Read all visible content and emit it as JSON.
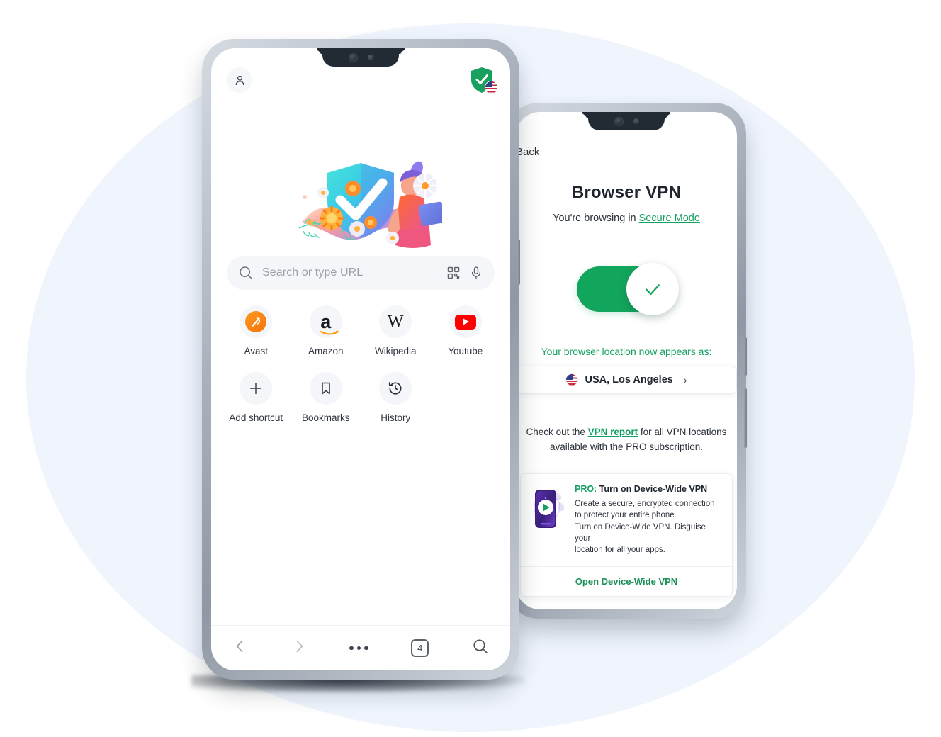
{
  "theme": {
    "brand_green": "#16a163",
    "toggle_green": "#12a55c",
    "bg_blob": "#eff4fd",
    "frame_dark": "#2b333c",
    "avast_orange": "#f4720b",
    "youtube_red": "#ff0000"
  },
  "phone1": {
    "profile_icon": "person-icon",
    "security_badge": {
      "shield_icon": "shield-check-icon",
      "flag_icon": "usa-flag-icon"
    },
    "hero_illustration": "shield-checkmark-flowers-illustration",
    "search": {
      "placeholder": "Search or type URL",
      "value": "",
      "search_icon": "search-icon",
      "qr_icon": "qr-code-icon",
      "mic_icon": "microphone-icon"
    },
    "shortcuts_row1": [
      {
        "label": "Avast",
        "icon": "avast-logo-icon"
      },
      {
        "label": "Amazon",
        "icon": "amazon-logo-icon"
      },
      {
        "label": "Wikipedia",
        "icon": "wikipedia-logo-icon"
      },
      {
        "label": "Youtube",
        "icon": "youtube-logo-icon"
      }
    ],
    "shortcuts_row2": [
      {
        "label": "Add shortcut",
        "icon": "plus-icon"
      },
      {
        "label": "Bookmarks",
        "icon": "bookmark-icon"
      },
      {
        "label": "History",
        "icon": "history-clock-icon"
      }
    ],
    "bottom_nav": {
      "back_icon": "chevron-left-icon",
      "forward_icon": "chevron-right-icon",
      "more_icon": "more-horizontal-icon",
      "tab_count": "4",
      "search_icon": "search-icon"
    }
  },
  "phone2": {
    "back_label": "Back",
    "title": "Browser VPN",
    "subtitle_prefix": "You're browsing in ",
    "subtitle_link": "Secure Mode",
    "toggle": {
      "state": "on",
      "check_icon": "check-icon"
    },
    "location_heading": "Your browser location now appears as:",
    "location_value": "USA, Los Angeles",
    "location_flag_icon": "usa-flag-icon",
    "location_chevron_icon": "chevron-right-icon",
    "report_line1_prefix": "Check out the ",
    "report_link": "VPN report",
    "report_line1_suffix": " for all VPN locations",
    "report_line2": "available with the PRO subscription.",
    "pro_card": {
      "art_icon": "phone-play-globe-icon",
      "tag": "PRO:",
      "title": " Turn on Device-Wide VPN",
      "desc_line1": "Create a secure, encrypted connection",
      "desc_line2": "to protect your entire phone.",
      "desc_line3": "Turn on Device-Wide VPN. Disguise your",
      "desc_line4": "location for all your apps.",
      "cta": "Open Device-Wide VPN"
    }
  }
}
